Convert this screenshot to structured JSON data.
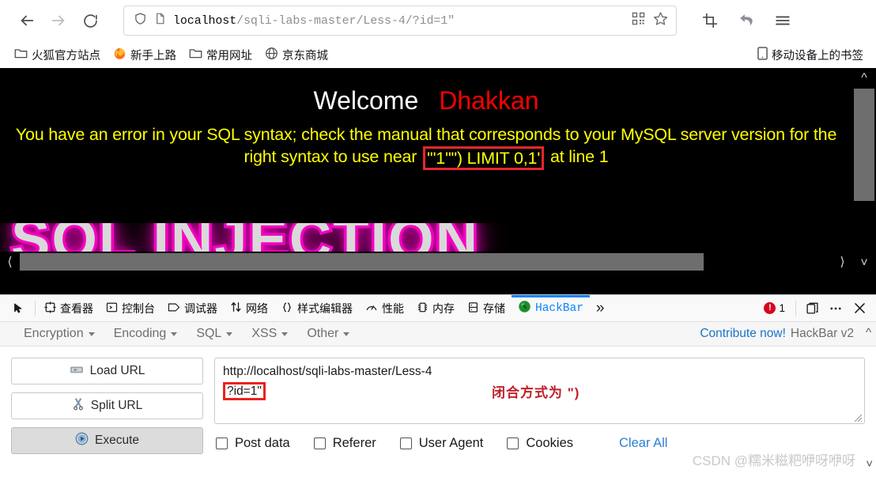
{
  "browser": {
    "nav": {
      "back_label": "Back",
      "forward_label": "Forward",
      "reload_label": "Reload"
    },
    "urlbar": {
      "host": "localhost",
      "path": "/sqli-labs-master/Less-4/?id=1\"",
      "full_url": "localhost/sqli-labs-master/Less-4/?id=1\"",
      "shield_icon": "shield-icon",
      "page-info_icon": "page-icon",
      "qr_icon": "qr-code-icon",
      "bookmark_icon": "star-icon"
    },
    "toolbar_icons": [
      "screenshot-icon",
      "undo-arrow-icon",
      "hamburger-menu-icon"
    ],
    "bookmarks": [
      {
        "label": "火狐官方站点",
        "icon": "folder-icon"
      },
      {
        "label": "新手上路",
        "icon": "firefox-icon"
      },
      {
        "label": "常用网址",
        "icon": "folder-icon"
      },
      {
        "label": "京东商城",
        "icon": "globe-icon"
      }
    ],
    "bookmarks_right": {
      "label": "移动设备上的书签",
      "icon": "mobile-device-icon"
    }
  },
  "page": {
    "welcome": "Welcome",
    "brand": "Dhakkan",
    "error_prefix": "You have an error in your SQL syntax; check the manual that corresponds to your MySQL server version for the right syntax to use near",
    "error_highlight": "'\"1\"\") LIMIT 0,1'",
    "error_suffix": "at line 1",
    "banner_text": "SQL INJECTION",
    "colors": {
      "background": "#000000",
      "welcome": "#ffffff",
      "brand": "#ff0000",
      "error": "#ffff00",
      "highlight_box": "#e8262c",
      "banner_glow": "#ff00c8"
    }
  },
  "devtools": {
    "picker_icon": "element-picker-icon",
    "tabs": [
      {
        "label": "查看器",
        "icon": "inspector-icon",
        "active": false
      },
      {
        "label": "控制台",
        "icon": "console-icon",
        "active": false
      },
      {
        "label": "调试器",
        "icon": "debugger-icon",
        "active": false
      },
      {
        "label": "网络",
        "icon": "network-icon",
        "active": false
      },
      {
        "label": "样式编辑器",
        "icon": "style-editor-icon",
        "active": false
      },
      {
        "label": "性能",
        "icon": "performance-icon",
        "active": false
      },
      {
        "label": "内存",
        "icon": "memory-icon",
        "active": false
      },
      {
        "label": "存储",
        "icon": "storage-icon",
        "active": false
      },
      {
        "label": "HackBar",
        "icon": "hackbar-icon",
        "active": true
      }
    ],
    "overflow_label": "»",
    "error_count": "1",
    "dock_icon": "dock-layout-icon",
    "meatball_icon": "more-options-icon",
    "close_icon": "close-icon"
  },
  "hackbar": {
    "menus": [
      {
        "label": "Encryption"
      },
      {
        "label": "Encoding"
      },
      {
        "label": "SQL"
      },
      {
        "label": "XSS"
      },
      {
        "label": "Other"
      }
    ],
    "contribute_link": "Contribute now!",
    "version_label": "HackBar v2",
    "collapse_icon": "chevron-up-icon",
    "buttons": [
      {
        "label": "Load URL",
        "icon": "load-url-icon",
        "primary": false
      },
      {
        "label": "Split URL",
        "icon": "scissors-icon",
        "primary": false
      },
      {
        "label": "Execute",
        "icon": "play-icon",
        "primary": true
      }
    ],
    "url_field": {
      "line1": "http://localhost/sqli-labs-master/Less-4",
      "line2": "?id=1\"",
      "annotation": "闭合方式为 \")"
    },
    "checkboxes": [
      {
        "label": "Post data",
        "checked": false
      },
      {
        "label": "Referer",
        "checked": false
      },
      {
        "label": "User Agent",
        "checked": false
      },
      {
        "label": "Cookies",
        "checked": false
      }
    ],
    "clear_all": "Clear All"
  },
  "watermark": "CSDN @糯米糍粑咿呀咿呀"
}
